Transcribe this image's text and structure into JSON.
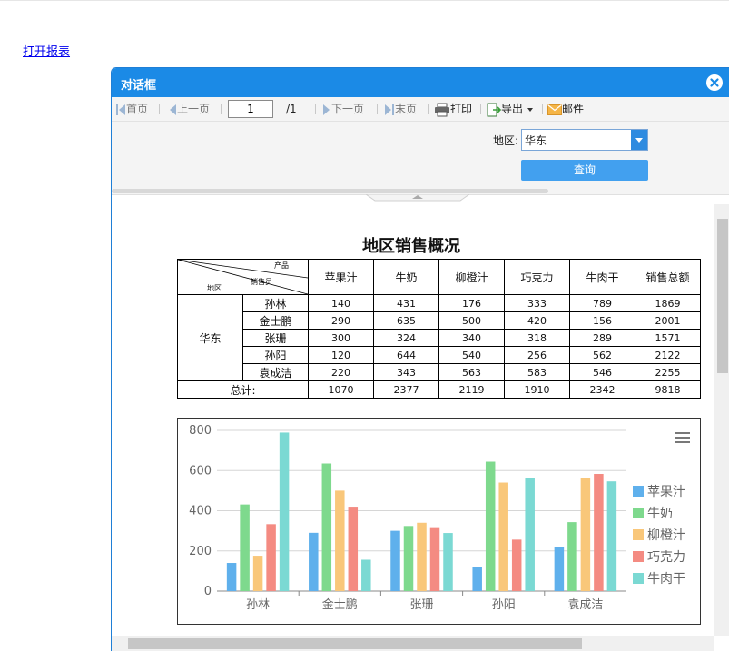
{
  "page": {
    "open_link": "打开报表"
  },
  "dialog": {
    "title": "对话框"
  },
  "toolbar": {
    "first": "首页",
    "prev": "上一页",
    "page_value": "1",
    "page_total": "/1",
    "next": "下一页",
    "last": "末页",
    "print": "打印",
    "export": "导出",
    "mail": "邮件"
  },
  "params": {
    "region_label": "地区:",
    "region_value": "华东",
    "query": "查询"
  },
  "report": {
    "title": "地区销售概况",
    "corner": {
      "product": "产品",
      "salesman": "销售员",
      "region": "地区"
    },
    "columns": [
      "苹果汁",
      "牛奶",
      "柳橙汁",
      "巧克力",
      "牛肉干",
      "销售总额"
    ],
    "region": "华东",
    "rows": [
      {
        "name": "孙林",
        "values": [
          "140",
          "431",
          "176",
          "333",
          "789",
          "1869"
        ]
      },
      {
        "name": "金士鹏",
        "values": [
          "290",
          "635",
          "500",
          "420",
          "156",
          "2001"
        ]
      },
      {
        "name": "张珊",
        "values": [
          "300",
          "324",
          "340",
          "318",
          "289",
          "1571"
        ]
      },
      {
        "name": "孙阳",
        "values": [
          "120",
          "644",
          "540",
          "256",
          "562",
          "2122"
        ]
      },
      {
        "name": "袁成洁",
        "values": [
          "220",
          "343",
          "563",
          "583",
          "546",
          "2255"
        ]
      }
    ],
    "total_label": "总计:",
    "totals": [
      "1070",
      "2377",
      "2119",
      "1910",
      "2342",
      "9818"
    ]
  },
  "chart_data": {
    "type": "bar",
    "categories": [
      "孙林",
      "金士鹏",
      "张珊",
      "孙阳",
      "袁成洁"
    ],
    "series": [
      {
        "name": "苹果汁",
        "values": [
          140,
          290,
          300,
          120,
          220
        ],
        "color": "#5fb0ec"
      },
      {
        "name": "牛奶",
        "values": [
          431,
          635,
          324,
          644,
          343
        ],
        "color": "#7ed98d"
      },
      {
        "name": "柳橙汁",
        "values": [
          176,
          500,
          340,
          540,
          563
        ],
        "color": "#f9c77a"
      },
      {
        "name": "巧克力",
        "values": [
          333,
          420,
          318,
          256,
          583
        ],
        "color": "#f48b82"
      },
      {
        "name": "牛肉干",
        "values": [
          789,
          156,
          289,
          562,
          546
        ],
        "color": "#7bd9d3"
      }
    ],
    "yticks": [
      0,
      200,
      400,
      600,
      800
    ],
    "ylim": [
      0,
      800
    ],
    "grid": true,
    "legend": "right"
  }
}
